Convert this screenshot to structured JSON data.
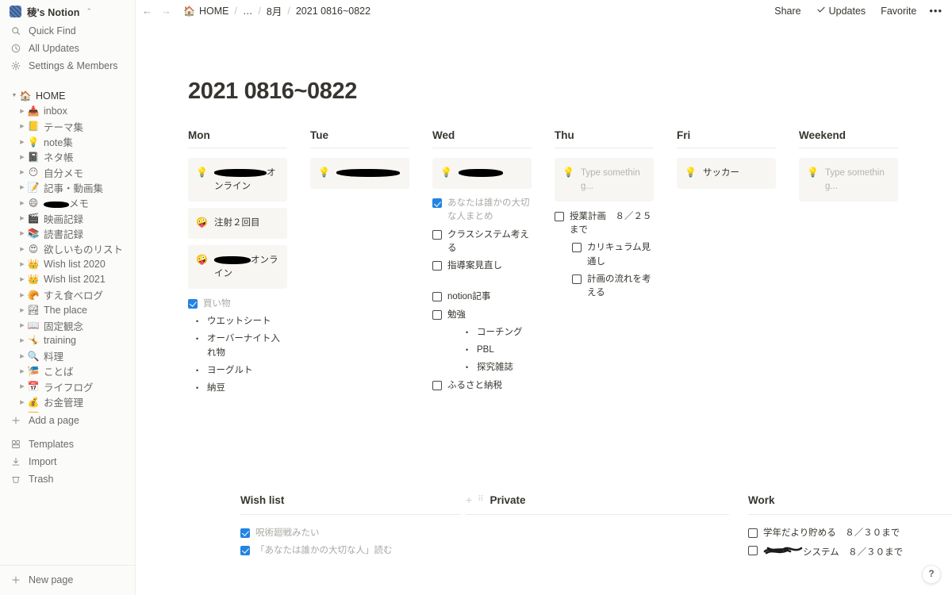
{
  "colors": {
    "accent": "#2383e2",
    "sidebar_bg": "#fbfbfa",
    "callout_bg": "#f7f6f3",
    "text": "#37352f",
    "muted": "#6b6a67"
  },
  "sidebar": {
    "workspace": {
      "name": "稜's Notion",
      "chevron": "chevron-updown-icon"
    },
    "nav": [
      {
        "icon": "search-icon",
        "label": "Quick Find"
      },
      {
        "icon": "clock-icon",
        "label": "All Updates"
      },
      {
        "icon": "gear-icon",
        "label": "Settings & Members"
      }
    ],
    "tree": [
      {
        "emoji": "🏠",
        "label": "HOME",
        "level": 0,
        "expanded": true
      },
      {
        "emoji": "📥",
        "label": "inbox",
        "level": 1
      },
      {
        "emoji": "📒",
        "label": "テーマ集",
        "level": 1
      },
      {
        "emoji": "💡",
        "label": "note集",
        "level": 1
      },
      {
        "emoji": "📓",
        "label": "ネタ帳",
        "level": 1
      },
      {
        "emoji": "😶",
        "label": "自分メモ",
        "level": 1
      },
      {
        "emoji": "📝",
        "label": "記事・動画集",
        "level": 1
      },
      {
        "emoji": "😄",
        "label": "メモ",
        "level": 1,
        "redacted": true
      },
      {
        "emoji": "🎬",
        "label": "映画記録",
        "level": 1
      },
      {
        "emoji": "📚",
        "label": "読書記録",
        "level": 1
      },
      {
        "emoji": "😍",
        "label": "欲しいものリスト",
        "level": 1
      },
      {
        "emoji": "👑",
        "label": "Wish list 2020",
        "level": 1
      },
      {
        "emoji": "👑",
        "label": "Wish list 2021",
        "level": 1
      },
      {
        "emoji": "🥐",
        "label": "すえ食べログ",
        "level": 1
      },
      {
        "emoji": "🏞",
        "label": "The place",
        "level": 1
      },
      {
        "emoji": "📖",
        "label": "固定観念",
        "level": 1
      },
      {
        "emoji": "🤸",
        "label": "training",
        "level": 1
      },
      {
        "emoji": "🔍",
        "label": "料理",
        "level": 1
      },
      {
        "emoji": "🎏",
        "label": "ことば",
        "level": 1
      },
      {
        "emoji": "📅",
        "label": "ライフログ",
        "level": 1
      },
      {
        "emoji": "💰",
        "label": "お金管理",
        "level": 1
      },
      {
        "emoji": "🈸",
        "label": "株　記録",
        "level": 1
      }
    ],
    "add_page": {
      "icon": "plus-icon",
      "label": "Add a page"
    },
    "bottom": [
      {
        "icon": "templates-icon",
        "label": "Templates"
      },
      {
        "icon": "import-icon",
        "label": "Import"
      },
      {
        "icon": "trash-icon",
        "label": "Trash"
      }
    ],
    "new_page": {
      "icon": "plus-icon",
      "label": "New page"
    }
  },
  "topbar": {
    "back": "←",
    "forward": "→",
    "breadcrumbs": [
      {
        "emoji": "🏠",
        "label": "HOME"
      },
      {
        "label": "…"
      },
      {
        "label": "8月"
      },
      {
        "label": "2021 0816~0822"
      }
    ],
    "separator": "/",
    "actions": [
      {
        "label": "Share",
        "icon": null
      },
      {
        "label": "Updates",
        "icon": "check-icon"
      },
      {
        "label": "Favorite",
        "icon": null
      }
    ],
    "more": "•••"
  },
  "page": {
    "title": "2021 0816~0822",
    "days": [
      {
        "name": "Mon",
        "callouts": [
          {
            "icon": "💡",
            "text": "オンライン",
            "redacted": true,
            "redact_width": 66,
            "placeholder": false
          },
          {
            "icon": "🤪",
            "text": "注射２回目",
            "redacted": false,
            "placeholder": false
          },
          {
            "icon": "🤪",
            "text": "オンライン",
            "redacted": true,
            "redact_width": 46,
            "placeholder": false
          }
        ],
        "blocks": [
          {
            "type": "todo",
            "checked": true,
            "text": "買い物",
            "indent": 0
          },
          {
            "type": "bullet",
            "text": "ウエットシート",
            "indent": 0
          },
          {
            "type": "bullet",
            "text": "オーバーナイト入れ物",
            "indent": 0
          },
          {
            "type": "bullet",
            "text": "ヨーグルト",
            "indent": 0
          },
          {
            "type": "bullet",
            "text": "納豆",
            "indent": 0
          }
        ]
      },
      {
        "name": "Tue",
        "callouts": [
          {
            "icon": "💡",
            "text": "",
            "redacted": true,
            "redact_width": 80,
            "placeholder": false
          }
        ],
        "blocks": []
      },
      {
        "name": "Wed",
        "callouts": [
          {
            "icon": "💡",
            "text": "",
            "redacted": true,
            "redact_width": 56,
            "placeholder": false
          }
        ],
        "blocks": [
          {
            "type": "todo",
            "checked": true,
            "text": "あなたは誰かの大切な人まとめ",
            "indent": 0
          },
          {
            "type": "todo",
            "checked": false,
            "text": "クラスシステム考える",
            "indent": 0
          },
          {
            "type": "todo",
            "checked": false,
            "text": "指導案見直し",
            "indent": 0
          },
          {
            "type": "spacer"
          },
          {
            "type": "todo",
            "checked": false,
            "text": "notion記事",
            "indent": 0
          },
          {
            "type": "todo",
            "checked": false,
            "text": "勉強",
            "indent": 0
          },
          {
            "type": "bullet",
            "text": "コーチング",
            "indent": 1
          },
          {
            "type": "bullet",
            "text": "PBL",
            "indent": 1
          },
          {
            "type": "bullet",
            "text": "探究雑誌",
            "indent": 1
          },
          {
            "type": "todo",
            "checked": false,
            "text": "ふるさと納税",
            "indent": 0
          }
        ]
      },
      {
        "name": "Thu",
        "callouts": [
          {
            "icon": "💡",
            "text": "Type something...",
            "redacted": false,
            "placeholder": true
          }
        ],
        "blocks": [
          {
            "type": "todo",
            "checked": false,
            "text": "授業計画　８／２５まで",
            "indent": 0
          },
          {
            "type": "todo",
            "checked": false,
            "text": "カリキュラム見通し",
            "indent": 1
          },
          {
            "type": "todo",
            "checked": false,
            "text": "計画の流れを考える",
            "indent": 1
          }
        ]
      },
      {
        "name": "Fri",
        "callouts": [
          {
            "icon": "💡",
            "text": "サッカー",
            "redacted": false,
            "placeholder": false
          }
        ],
        "blocks": []
      },
      {
        "name": "Weekend",
        "callouts": [
          {
            "icon": "💡",
            "text": "Type something...",
            "redacted": false,
            "placeholder": true
          }
        ],
        "blocks": []
      }
    ],
    "bottom_sections": [
      {
        "title": "Wish list",
        "has_add": false,
        "blocks": [
          {
            "type": "todo",
            "checked": true,
            "text": "呪術廻戦みたい",
            "indent": 0
          },
          {
            "type": "todo",
            "checked": true,
            "text": "「あなたは誰かの大切な人」読む",
            "indent": 0
          }
        ]
      },
      {
        "title": "Private",
        "has_add": true,
        "add_icon": "plus-icon",
        "grip_icon": "drag-handle-icon",
        "blocks": []
      },
      {
        "title": "Work",
        "has_add": false,
        "blocks": [
          {
            "type": "todo",
            "checked": false,
            "text": "学年だより貯める　８／３０まで",
            "indent": 0
          },
          {
            "type": "todo",
            "checked": false,
            "text": "システム　８／３０まで",
            "indent": 0,
            "scribbled": true
          }
        ]
      }
    ]
  },
  "help": {
    "label": "?",
    "name": "help-button"
  }
}
